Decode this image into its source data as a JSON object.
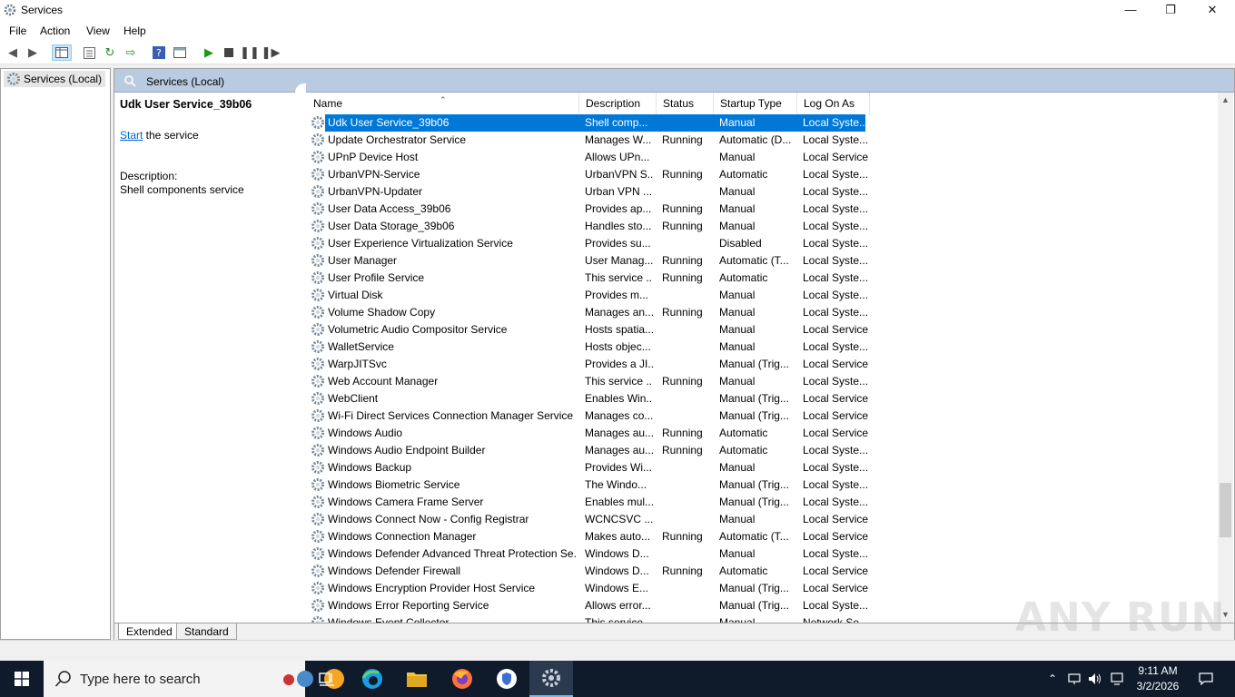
{
  "window": {
    "title": "Services"
  },
  "menu": [
    "File",
    "Action",
    "View",
    "Help"
  ],
  "tree": {
    "root": "Services (Local)"
  },
  "header": {
    "title": "Services (Local)"
  },
  "extended": {
    "service_name": "Udk User Service_39b06",
    "start_link": "Start",
    "start_suffix": " the service",
    "description_label": "Description:",
    "description": "Shell components service"
  },
  "columns": [
    "Name",
    "Description",
    "Status",
    "Startup Type",
    "Log On As"
  ],
  "rows": [
    {
      "name": "Udk User Service_39b06",
      "description": "Shell comp...",
      "status": "",
      "startup": "Manual",
      "logon": "Local Syste...",
      "selected": true
    },
    {
      "name": "Update Orchestrator Service",
      "description": "Manages W...",
      "status": "Running",
      "startup": "Automatic (D...",
      "logon": "Local Syste..."
    },
    {
      "name": "UPnP Device Host",
      "description": "Allows UPn...",
      "status": "",
      "startup": "Manual",
      "logon": "Local Service"
    },
    {
      "name": "UrbanVPN-Service",
      "description": "UrbanVPN S...",
      "status": "Running",
      "startup": "Automatic",
      "logon": "Local Syste..."
    },
    {
      "name": "UrbanVPN-Updater",
      "description": "Urban VPN ...",
      "status": "",
      "startup": "Manual",
      "logon": "Local Syste..."
    },
    {
      "name": "User Data Access_39b06",
      "description": "Provides ap...",
      "status": "Running",
      "startup": "Manual",
      "logon": "Local Syste..."
    },
    {
      "name": "User Data Storage_39b06",
      "description": "Handles sto...",
      "status": "Running",
      "startup": "Manual",
      "logon": "Local Syste..."
    },
    {
      "name": "User Experience Virtualization Service",
      "description": "Provides su...",
      "status": "",
      "startup": "Disabled",
      "logon": "Local Syste..."
    },
    {
      "name": "User Manager",
      "description": "User Manag...",
      "status": "Running",
      "startup": "Automatic (T...",
      "logon": "Local Syste..."
    },
    {
      "name": "User Profile Service",
      "description": "This service ...",
      "status": "Running",
      "startup": "Automatic",
      "logon": "Local Syste..."
    },
    {
      "name": "Virtual Disk",
      "description": "Provides m...",
      "status": "",
      "startup": "Manual",
      "logon": "Local Syste..."
    },
    {
      "name": "Volume Shadow Copy",
      "description": "Manages an...",
      "status": "Running",
      "startup": "Manual",
      "logon": "Local Syste..."
    },
    {
      "name": "Volumetric Audio Compositor Service",
      "description": "Hosts spatia...",
      "status": "",
      "startup": "Manual",
      "logon": "Local Service"
    },
    {
      "name": "WalletService",
      "description": "Hosts objec...",
      "status": "",
      "startup": "Manual",
      "logon": "Local Syste..."
    },
    {
      "name": "WarpJITSvc",
      "description": "Provides a JI...",
      "status": "",
      "startup": "Manual (Trig...",
      "logon": "Local Service"
    },
    {
      "name": "Web Account Manager",
      "description": "This service ...",
      "status": "Running",
      "startup": "Manual",
      "logon": "Local Syste..."
    },
    {
      "name": "WebClient",
      "description": "Enables Win...",
      "status": "",
      "startup": "Manual (Trig...",
      "logon": "Local Service"
    },
    {
      "name": "Wi-Fi Direct Services Connection Manager Service",
      "description": "Manages co...",
      "status": "",
      "startup": "Manual (Trig...",
      "logon": "Local Service"
    },
    {
      "name": "Windows Audio",
      "description": "Manages au...",
      "status": "Running",
      "startup": "Automatic",
      "logon": "Local Service"
    },
    {
      "name": "Windows Audio Endpoint Builder",
      "description": "Manages au...",
      "status": "Running",
      "startup": "Automatic",
      "logon": "Local Syste..."
    },
    {
      "name": "Windows Backup",
      "description": "Provides Wi...",
      "status": "",
      "startup": "Manual",
      "logon": "Local Syste..."
    },
    {
      "name": "Windows Biometric Service",
      "description": "The Windo...",
      "status": "",
      "startup": "Manual (Trig...",
      "logon": "Local Syste..."
    },
    {
      "name": "Windows Camera Frame Server",
      "description": "Enables mul...",
      "status": "",
      "startup": "Manual (Trig...",
      "logon": "Local Syste..."
    },
    {
      "name": "Windows Connect Now - Config Registrar",
      "description": "WCNCSVC ...",
      "status": "",
      "startup": "Manual",
      "logon": "Local Service"
    },
    {
      "name": "Windows Connection Manager",
      "description": "Makes auto...",
      "status": "Running",
      "startup": "Automatic (T...",
      "logon": "Local Service"
    },
    {
      "name": "Windows Defender Advanced Threat Protection Se...",
      "description": "Windows D...",
      "status": "",
      "startup": "Manual",
      "logon": "Local Syste..."
    },
    {
      "name": "Windows Defender Firewall",
      "description": "Windows D...",
      "status": "Running",
      "startup": "Automatic",
      "logon": "Local Service"
    },
    {
      "name": "Windows Encryption Provider Host Service",
      "description": "Windows E...",
      "status": "",
      "startup": "Manual (Trig...",
      "logon": "Local Service"
    },
    {
      "name": "Windows Error Reporting Service",
      "description": "Allows error...",
      "status": "",
      "startup": "Manual (Trig...",
      "logon": "Local Syste..."
    },
    {
      "name": "Windows Event Collector",
      "description": "This service ...",
      "status": "",
      "startup": "Manual",
      "logon": "Network Se..."
    }
  ],
  "tabs": [
    "Extended",
    "Standard"
  ],
  "taskbar": {
    "search_placeholder": "Type here to search",
    "time": "9:11 AM",
    "date": "3/2/2026"
  },
  "watermark": "ANY RUN",
  "colors": {
    "selection": "#0078d7",
    "header": "#b8cbe0",
    "taskbar": "#0f1a2b",
    "link": "#0066cc"
  }
}
